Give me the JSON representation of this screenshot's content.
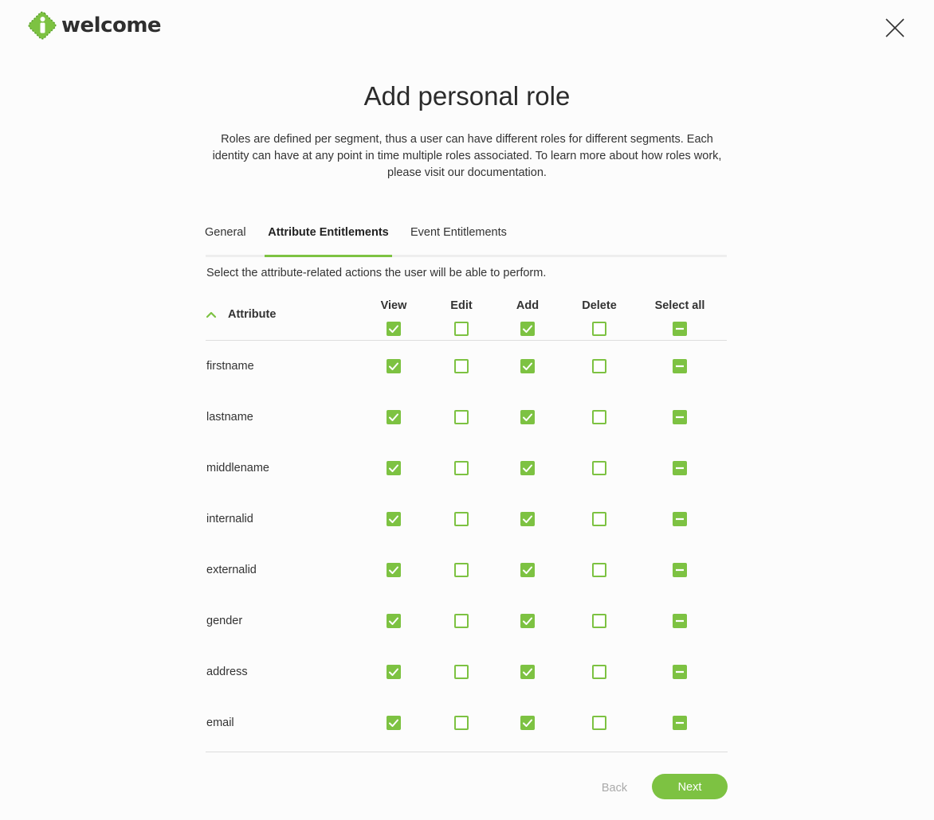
{
  "brand": {
    "name": "welcome",
    "accent_color": "#7dc242",
    "logo_icon": "i-info-diamond-icon"
  },
  "header": {
    "close_icon": "close-icon"
  },
  "page": {
    "title": "Add personal role",
    "description": "Roles are defined per segment, thus a user can have different roles for different segments. Each identity can have at any point in time multiple roles associated. To learn more about how roles work, please visit our documentation."
  },
  "tabs": [
    {
      "label": "General",
      "active": false
    },
    {
      "label": "Attribute Entitlements",
      "active": true
    },
    {
      "label": "Event Entitlements",
      "active": false
    }
  ],
  "instruction": "Select the attribute-related actions the user will be able to perform.",
  "table": {
    "attribute_header": "Attribute",
    "sort_icon": "chevron-up-icon",
    "columns": [
      "View",
      "Edit",
      "Add",
      "Delete",
      "Select all"
    ],
    "header_states": [
      "checked",
      "unchecked",
      "checked",
      "unchecked",
      "indeterminate"
    ],
    "rows": [
      {
        "name": "firstname",
        "states": [
          "checked",
          "unchecked",
          "checked",
          "unchecked",
          "indeterminate"
        ]
      },
      {
        "name": "lastname",
        "states": [
          "checked",
          "unchecked",
          "checked",
          "unchecked",
          "indeterminate"
        ]
      },
      {
        "name": "middlename",
        "states": [
          "checked",
          "unchecked",
          "checked",
          "unchecked",
          "indeterminate"
        ]
      },
      {
        "name": "internalid",
        "states": [
          "checked",
          "unchecked",
          "checked",
          "unchecked",
          "indeterminate"
        ]
      },
      {
        "name": "externalid",
        "states": [
          "checked",
          "unchecked",
          "checked",
          "unchecked",
          "indeterminate"
        ]
      },
      {
        "name": "gender",
        "states": [
          "checked",
          "unchecked",
          "checked",
          "unchecked",
          "indeterminate"
        ]
      },
      {
        "name": "address",
        "states": [
          "checked",
          "unchecked",
          "checked",
          "unchecked",
          "indeterminate"
        ]
      },
      {
        "name": "email",
        "states": [
          "checked",
          "unchecked",
          "checked",
          "unchecked",
          "indeterminate"
        ]
      }
    ]
  },
  "footer": {
    "back_label": "Back",
    "next_label": "Next"
  }
}
